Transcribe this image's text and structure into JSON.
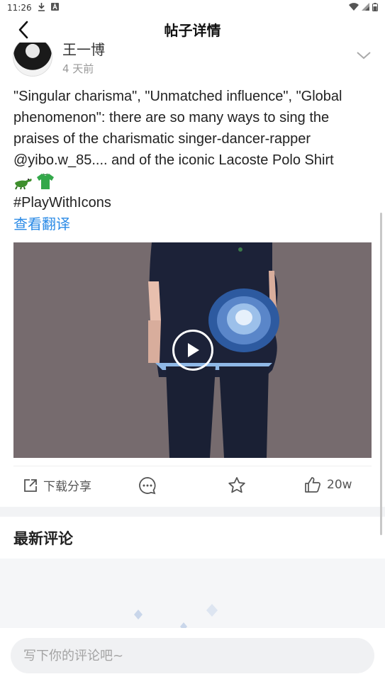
{
  "status": {
    "time": "11:26"
  },
  "header": {
    "title": "帖子详情"
  },
  "author": {
    "name": "王一博",
    "time": "4 天前"
  },
  "post": {
    "text": "\"Singular charisma\", \"Unmatched influence\", \"Global phenomenon\": there are so many ways to sing the praises of the charismatic singer-dancer-rapper @yibo.w_85.... and of the iconic Lacoste Polo Shirt",
    "emojis": [
      "crocodile-emoji",
      "tshirt-emoji"
    ],
    "hashtag": "#PlayWithIcons",
    "translate": "查看翻译"
  },
  "actions": {
    "share": "下载分享",
    "like_count": "20w"
  },
  "comments": {
    "title": "最新评论",
    "placeholder": "写下你的评论吧~"
  },
  "colors": {
    "link": "#2a8ae6",
    "media_bg": "#766b6e",
    "polo_navy": "#1b2238",
    "flower_blue": "#5a86c9"
  }
}
